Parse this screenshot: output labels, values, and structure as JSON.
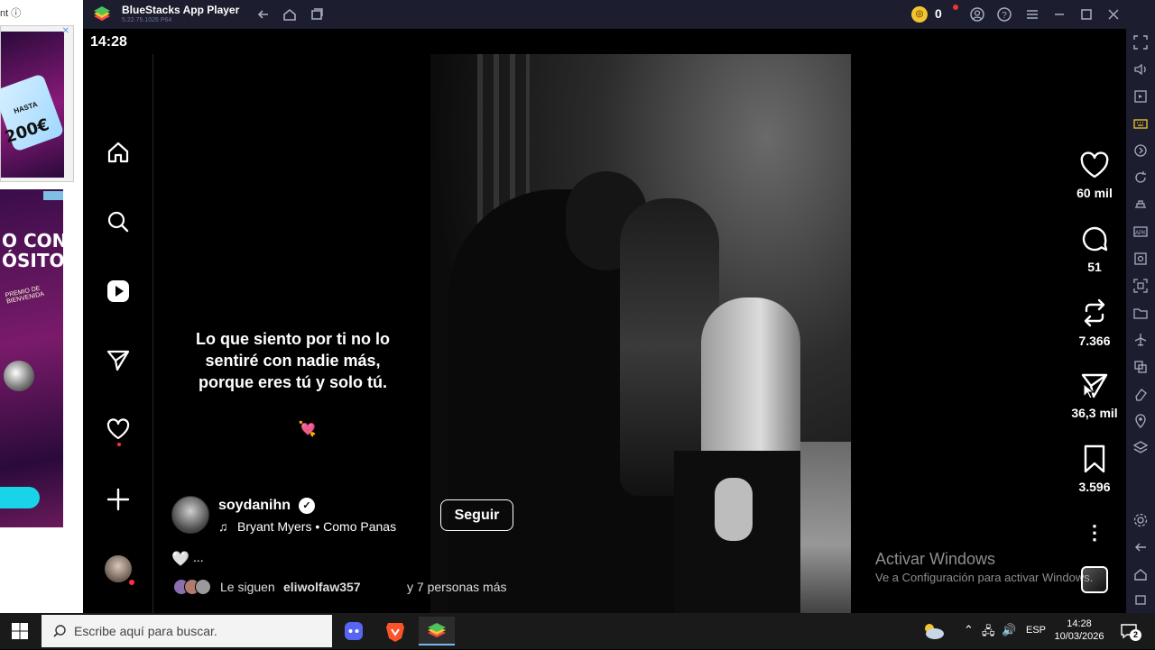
{
  "browser_ad": {
    "top_text": "nt ⓘ",
    "ad1_text": "200€",
    "ad1_small": "HASTA",
    "ad2_heading": "O CON\nÓSITO!",
    "ad2_tag": "PREMIO DE BIENVENIDA",
    "close_glyph": "✕"
  },
  "emulator": {
    "title": "BlueStacks App Player",
    "version": "5.22.75.1026  P64",
    "coins": "0",
    "coin_glyph": "🪙"
  },
  "android": {
    "clock": "14:28"
  },
  "instagram": {
    "nav": [
      "home-icon",
      "search-icon",
      "reels-icon",
      "messages-icon",
      "notifications-icon",
      "create-icon",
      "profile-avatar"
    ],
    "reel": {
      "caption_lines": [
        "Lo que siento por ti no lo",
        "sentiré con nadie más,",
        "porque eres tú y solo tú."
      ],
      "caption_emoji": "💘",
      "author": "soydanihn",
      "verified_glyph": "✓",
      "music_glyph": "♫",
      "music": "Bryant Myers • Como Panas",
      "follow_label": "Seguir",
      "like_mini_glyph": "🤍",
      "like_mini_text": "...",
      "followers_prefix": "Le siguen",
      "followers_user": "eliwolfaw357",
      "followers_suffix": "y 7 personas más"
    },
    "actions": {
      "likes": "60 mil",
      "comments": "51",
      "reposts": "7.366",
      "shares": "36,3 mil",
      "saves": "3.596",
      "more_glyph": "⋮"
    }
  },
  "watermark": {
    "title": "Activar Windows",
    "subtitle": "Ve a Configuración para activar Windows."
  },
  "taskbar": {
    "search_placeholder": "Escribe aquí para buscar.",
    "lang": "ESP",
    "time": "14:28",
    "date": "10/03/2026",
    "notifications": "2",
    "tray_up_glyph": "⌃",
    "tray_net_glyph": "🖧",
    "tray_sound_glyph": "🔊"
  },
  "colors": {
    "emulator_chrome": "#1c1d2e",
    "like_dot": "#ff3040",
    "discord": "#5865f2",
    "brave": "#fb542b"
  }
}
